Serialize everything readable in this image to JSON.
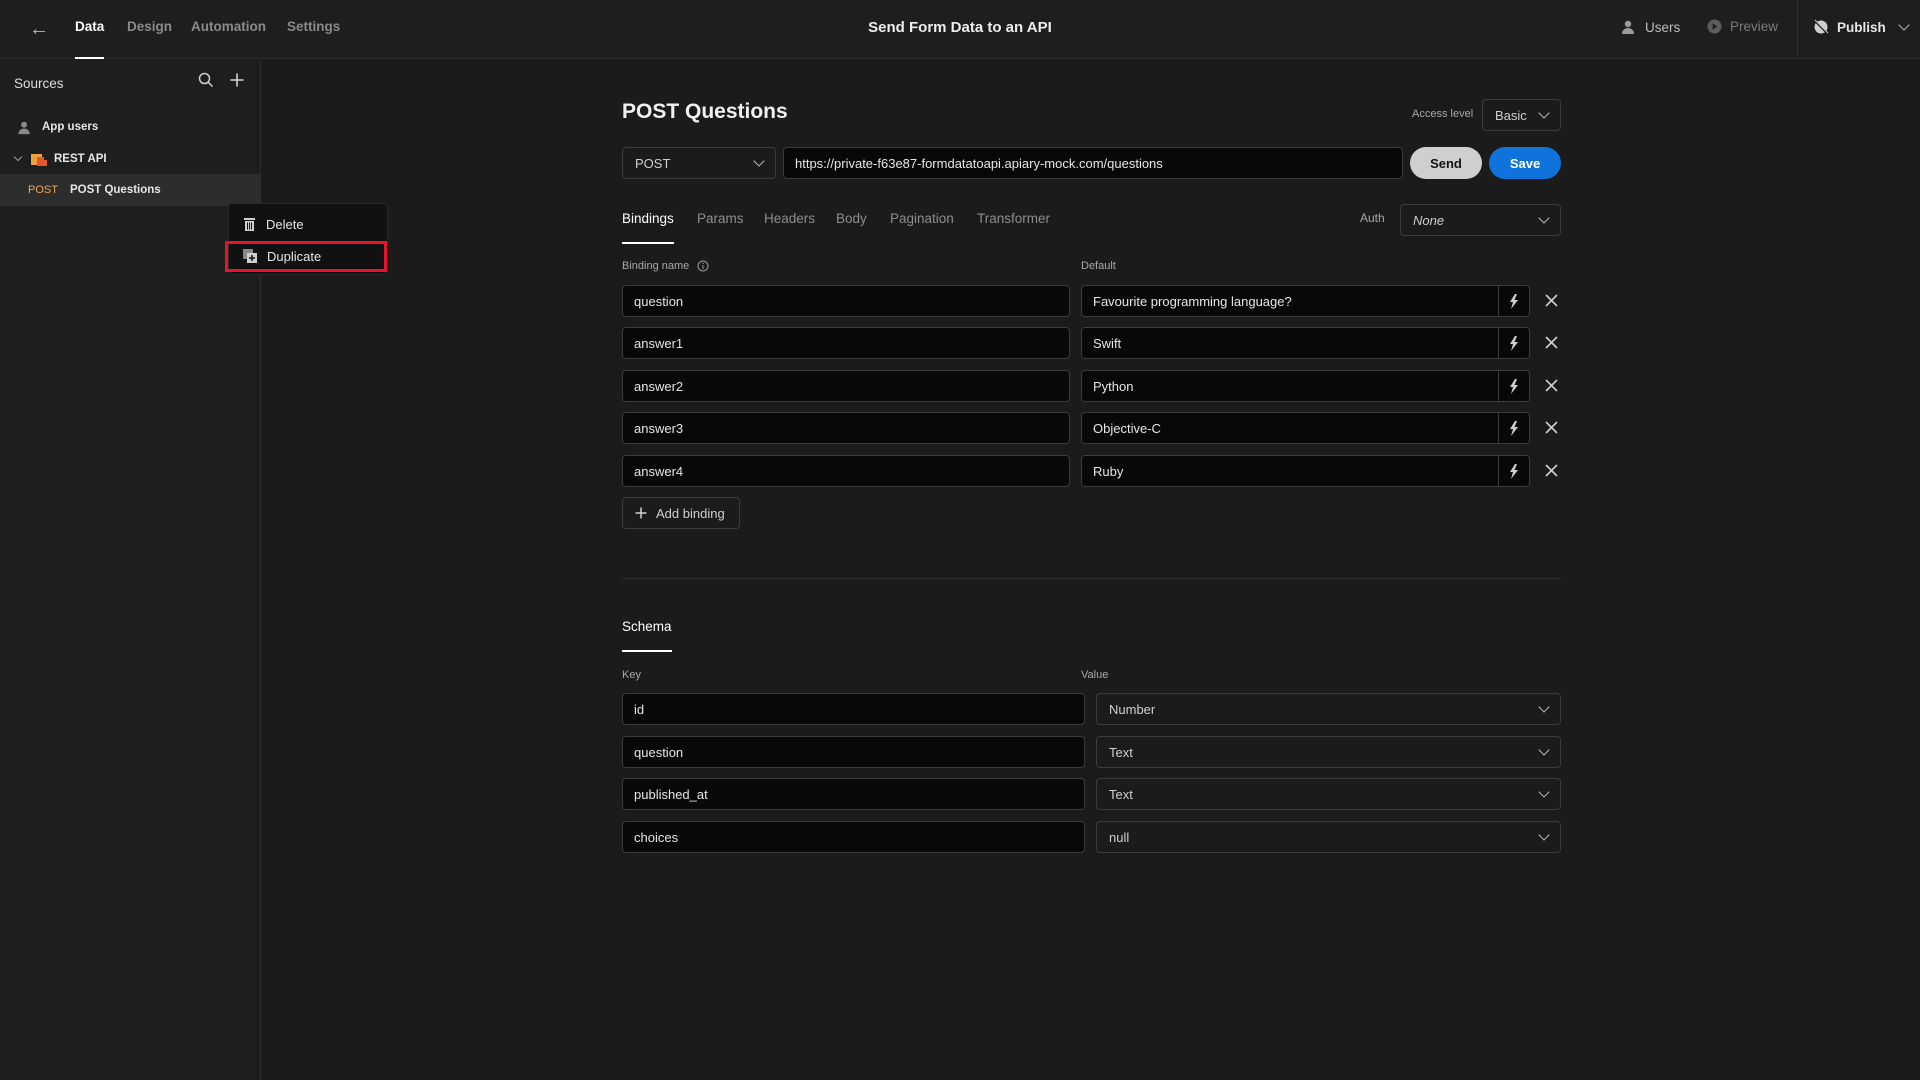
{
  "header": {
    "back_icon": "arrow-left-icon",
    "nav_tabs": [
      {
        "label": "Data",
        "active": true
      },
      {
        "label": "Design",
        "active": false
      },
      {
        "label": "Automation",
        "active": false
      },
      {
        "label": "Settings",
        "active": false
      }
    ],
    "app_title": "Send Form Data to an API",
    "users_label": "Users",
    "preview_label": "Preview",
    "publish_label": "Publish"
  },
  "sidebar": {
    "title": "Sources",
    "items": [
      {
        "label": "App users",
        "icon": "users-icon"
      },
      {
        "label": "REST API",
        "icon": "rest-api-icon",
        "expanded": true
      },
      {
        "method": "POST",
        "label": "POST Questions",
        "selected": true
      }
    ]
  },
  "context_menu": {
    "items": [
      {
        "label": "Delete",
        "icon": "trash-icon"
      },
      {
        "label": "Duplicate",
        "icon": "duplicate-icon",
        "highlighted": true
      }
    ],
    "highlight_color": "#e8142c"
  },
  "query": {
    "title": "POST Questions",
    "access_level_label": "Access level",
    "access_level_value": "Basic",
    "method": "POST",
    "url": "https://private-f63e87-formdatatoapi.apiary-mock.com/questions",
    "send_label": "Send",
    "save_label": "Save",
    "save_color": "#0f73db",
    "tabs": [
      {
        "label": "Bindings",
        "active": true
      },
      {
        "label": "Params",
        "active": false
      },
      {
        "label": "Headers",
        "active": false
      },
      {
        "label": "Body",
        "active": false
      },
      {
        "label": "Pagination",
        "active": false
      },
      {
        "label": "Transformer",
        "active": false
      }
    ],
    "auth_label": "Auth",
    "auth_value": "None"
  },
  "bindings": {
    "name_header": "Binding name",
    "default_header": "Default",
    "rows": [
      {
        "name": "question",
        "default": "Favourite programming language?"
      },
      {
        "name": "answer1",
        "default": "Swift"
      },
      {
        "name": "answer2",
        "default": "Python"
      },
      {
        "name": "answer3",
        "default": "Objective-C"
      },
      {
        "name": "answer4",
        "default": "Ruby"
      }
    ],
    "add_label": "Add binding"
  },
  "schema": {
    "tab_label": "Schema",
    "key_header": "Key",
    "value_header": "Value",
    "rows": [
      {
        "key": "id",
        "value": "Number"
      },
      {
        "key": "question",
        "value": "Text"
      },
      {
        "key": "published_at",
        "value": "Text"
      },
      {
        "key": "choices",
        "value": "null"
      }
    ]
  }
}
